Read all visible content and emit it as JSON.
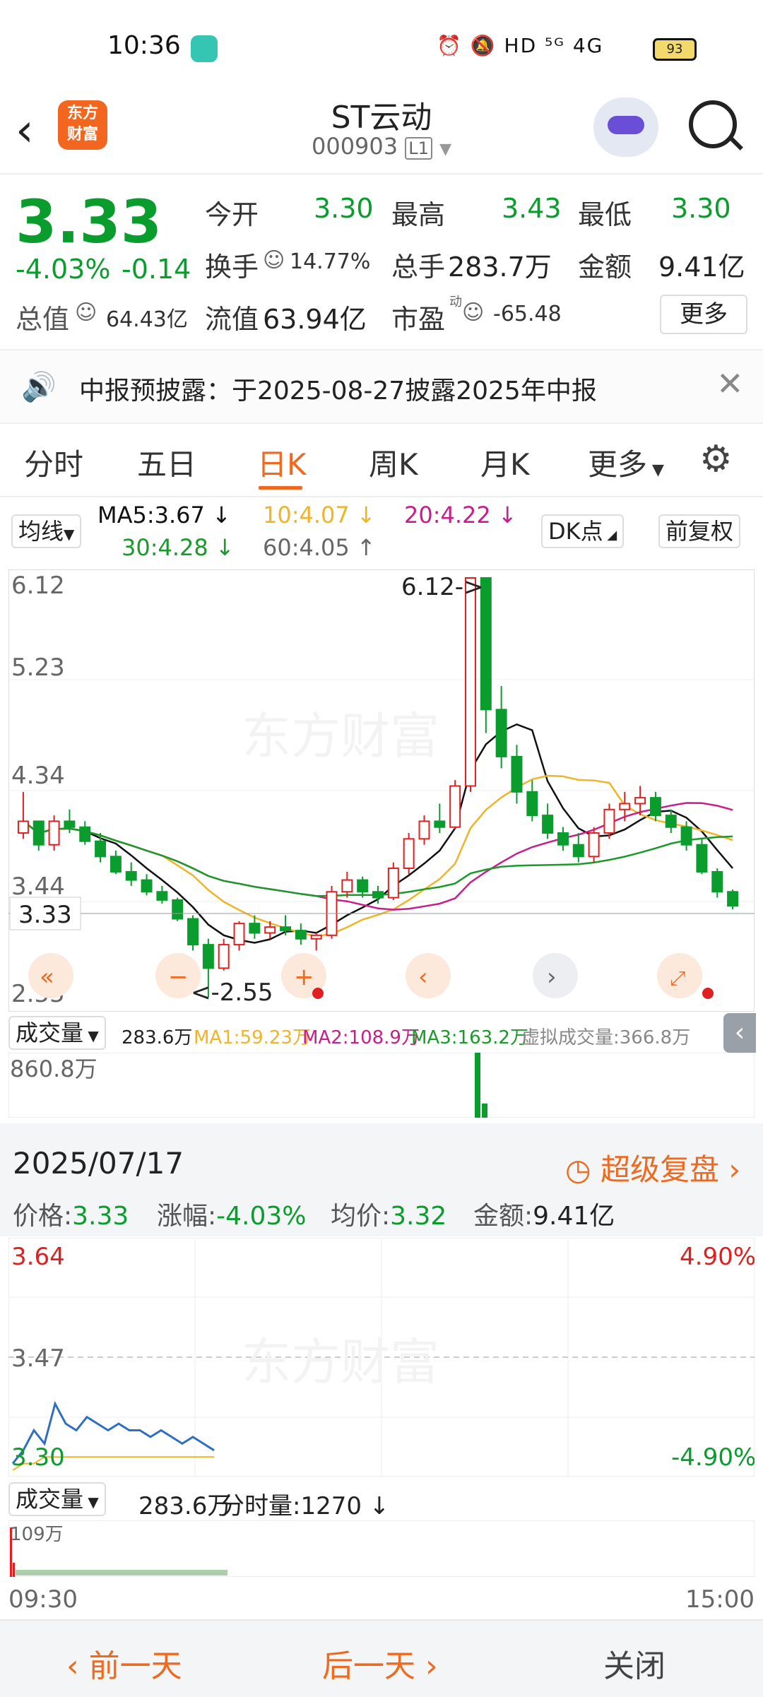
{
  "status_bar": {
    "time": "10:36",
    "icons": "⏰ 🔕 HD ⁵ᴳ 4G",
    "battery": "93"
  },
  "header": {
    "stock_name": "ST云动",
    "stock_code": "000903",
    "level_badge": "L1",
    "logo_text_1": "东方",
    "logo_text_2": "财富"
  },
  "quote": {
    "price": "3.33",
    "change_pct": "-4.03%",
    "change_amt": "-0.14",
    "open_label": "今开",
    "open": "3.30",
    "high_label": "最高",
    "high": "3.43",
    "low_label": "最低",
    "low": "3.30",
    "turnover_label": "换手",
    "turnover": "14.77%",
    "volume_label": "总手",
    "volume": "283.7万",
    "amount_label": "金额",
    "amount": "9.41亿",
    "mktcap_label": "总值",
    "mktcap": "64.43亿",
    "float_label": "流值",
    "float_cap": "63.94亿",
    "pe_label": "市盈",
    "pe_sup": "动",
    "pe": "-65.48",
    "more": "更多"
  },
  "notice": {
    "text": "中报预披露：于2025-08-27披露2025年中报"
  },
  "tabs": [
    "分时",
    "五日",
    "日K",
    "周K",
    "月K",
    "更多"
  ],
  "ma_legend": {
    "selector": "均线",
    "ma5": "MA5:3.67",
    "ma10": "10:4.07",
    "ma20": "20:4.22",
    "ma30": "30:4.28",
    "ma60": "60:4.05",
    "dk": "DK点",
    "adjust": "前复权"
  },
  "kchart_labels": {
    "y_top": "6.12",
    "y_2": "5.23",
    "y_3": "4.34",
    "y_4": "3.44",
    "y_bottom": "2.55",
    "current": "3.33",
    "max_marker": "6.12->",
    "min_marker": "<-2.55"
  },
  "volume_legend": {
    "selector": "成交量",
    "vol": "283.6万",
    "ma1": "MA1:59.23万",
    "ma2": "MA2:108.9万",
    "ma3": "MA3:163.2万",
    "virtual": "虚拟成交量:366.8万",
    "scale_max": "860.8万"
  },
  "detail": {
    "date": "2025/07/17",
    "replay": "超级复盘",
    "price_label": "价格:",
    "price": "3.33",
    "pct_label": "涨幅:",
    "pct": "-4.03%",
    "avg_label": "均价:",
    "avg": "3.32",
    "amount_label": "金额:",
    "amount": "9.41亿"
  },
  "intraday": {
    "y_top": "3.64",
    "y_mid": "3.47",
    "y_bottom": "3.30",
    "pct_top": "4.90%",
    "pct_bottom": "-4.90%",
    "vol_selector": "成交量",
    "vol": "283.6万",
    "tick_vol": "分时量:1270",
    "vol_scale": "109万",
    "time_start": "09:30",
    "time_end": "15:00"
  },
  "bottom_nav": {
    "prev": "前一天",
    "next": "后一天",
    "close": "关闭"
  },
  "colors": {
    "green": "#0a9d2e",
    "red": "#e02020",
    "orange": "#ef6a1f",
    "ma5": "#111111",
    "ma10": "#f0b429",
    "ma20": "#c81d8a",
    "ma30": "#1a9a2a",
    "ma60": "#666666"
  },
  "chart_data": {
    "type": "candlestick",
    "ylim": [
      2.55,
      6.12
    ],
    "candles": [
      [
        3.95,
        4.3,
        3.9,
        4.05
      ],
      [
        4.05,
        4.05,
        3.8,
        3.85
      ],
      [
        3.85,
        4.1,
        3.8,
        4.05
      ],
      [
        4.05,
        4.15,
        3.95,
        4.0
      ],
      [
        4.0,
        4.05,
        3.85,
        3.88
      ],
      [
        3.88,
        3.95,
        3.7,
        3.75
      ],
      [
        3.75,
        3.8,
        3.6,
        3.62
      ],
      [
        3.62,
        3.7,
        3.5,
        3.55
      ],
      [
        3.55,
        3.6,
        3.42,
        3.45
      ],
      [
        3.45,
        3.5,
        3.35,
        3.38
      ],
      [
        3.38,
        3.4,
        3.2,
        3.22
      ],
      [
        3.22,
        3.25,
        2.95,
        3.0
      ],
      [
        3.0,
        3.05,
        2.55,
        2.8
      ],
      [
        2.8,
        3.05,
        2.78,
        3.0
      ],
      [
        3.0,
        3.2,
        2.95,
        3.18
      ],
      [
        3.18,
        3.25,
        3.05,
        3.1
      ],
      [
        3.1,
        3.2,
        3.05,
        3.15
      ],
      [
        3.15,
        3.25,
        3.08,
        3.12
      ],
      [
        3.12,
        3.18,
        3.0,
        3.05
      ],
      [
        3.05,
        3.1,
        2.95,
        3.08
      ],
      [
        3.08,
        3.5,
        3.05,
        3.45
      ],
      [
        3.45,
        3.62,
        3.4,
        3.55
      ],
      [
        3.55,
        3.58,
        3.4,
        3.45
      ],
      [
        3.45,
        3.5,
        3.35,
        3.4
      ],
      [
        3.4,
        3.7,
        3.38,
        3.65
      ],
      [
        3.65,
        3.95,
        3.6,
        3.9
      ],
      [
        3.9,
        4.1,
        3.85,
        4.05
      ],
      [
        4.05,
        4.2,
        3.95,
        4.0
      ],
      [
        4.0,
        4.4,
        3.98,
        4.35
      ],
      [
        4.35,
        6.12,
        4.3,
        6.12
      ],
      [
        6.12,
        5.4,
        4.8,
        5.0
      ],
      [
        5.0,
        5.2,
        4.5,
        4.6
      ],
      [
        4.6,
        4.7,
        4.2,
        4.3
      ],
      [
        4.3,
        4.4,
        4.05,
        4.1
      ],
      [
        4.1,
        4.2,
        3.9,
        3.95
      ],
      [
        3.95,
        4.0,
        3.8,
        3.85
      ],
      [
        3.85,
        3.95,
        3.7,
        3.75
      ],
      [
        3.75,
        4.0,
        3.7,
        3.95
      ],
      [
        3.95,
        4.2,
        3.9,
        4.15
      ],
      [
        4.15,
        4.3,
        4.05,
        4.2
      ],
      [
        4.2,
        4.35,
        4.1,
        4.25
      ],
      [
        4.25,
        4.3,
        4.05,
        4.1
      ],
      [
        4.1,
        4.15,
        3.95,
        4.0
      ],
      [
        4.0,
        4.05,
        3.8,
        3.85
      ],
      [
        3.85,
        3.9,
        3.6,
        3.62
      ],
      [
        3.62,
        3.65,
        3.4,
        3.45
      ],
      [
        3.45,
        3.47,
        3.3,
        3.33
      ]
    ],
    "volumes": [],
    "intraday_series": [
      3.31,
      3.33,
      3.36,
      3.34,
      3.4,
      3.37,
      3.36,
      3.38,
      3.37,
      3.36,
      3.37,
      3.36,
      3.36,
      3.35,
      3.36,
      3.35,
      3.34,
      3.35,
      3.34,
      3.33
    ],
    "intraday_avg": [
      3.3,
      3.31,
      3.31,
      3.32,
      3.32,
      3.32,
      3.32,
      3.32,
      3.32,
      3.32,
      3.32,
      3.32,
      3.32,
      3.32,
      3.32,
      3.32,
      3.32,
      3.32,
      3.32,
      3.32
    ]
  }
}
